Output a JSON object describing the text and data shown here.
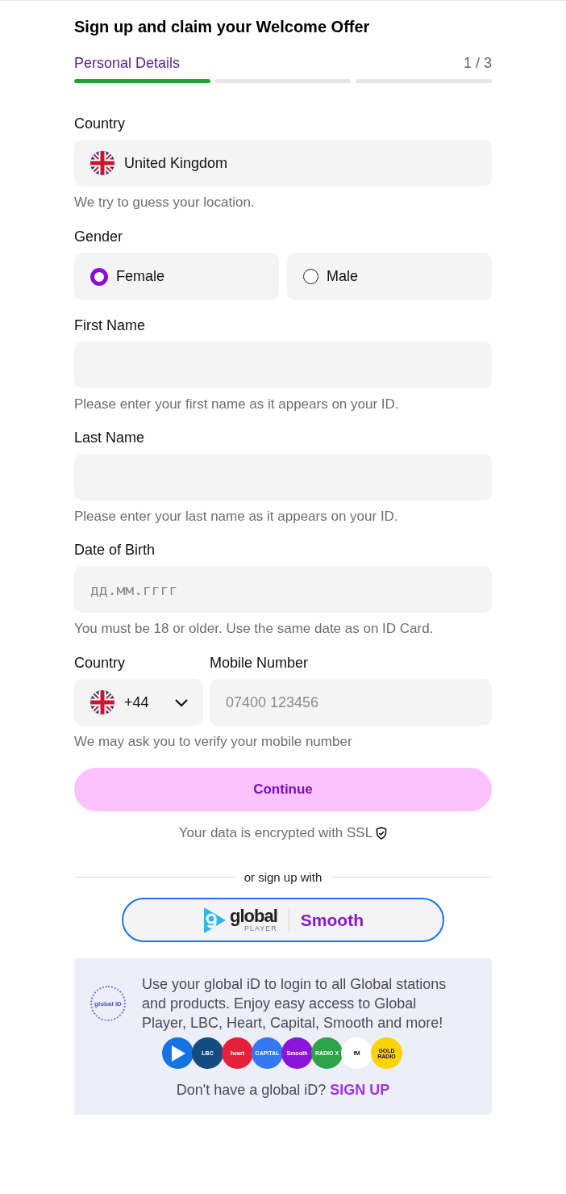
{
  "title": "Sign up and claim your Welcome Offer",
  "progress": {
    "label": "Personal Details",
    "counter": "1 / 3",
    "steps": [
      {
        "completed": true
      },
      {
        "completed": false
      },
      {
        "completed": false
      }
    ]
  },
  "fields": [
    {
      "kind": "country",
      "label": "Country",
      "value": "United Kingdom",
      "helper": "We try to guess your location."
    },
    {
      "kind": "radio",
      "label": "Gender",
      "options": [
        {
          "label": "Female",
          "selected": true
        },
        {
          "label": "Male",
          "selected": false
        }
      ]
    },
    {
      "kind": "text",
      "label": "First Name",
      "helper": "Please enter your first name as it appears on your ID."
    },
    {
      "kind": "text",
      "label": "Last Name",
      "helper": "Please enter your last name as it appears on your ID."
    },
    {
      "kind": "date",
      "label": "Date of Birth",
      "placeholder": "дд.мм.гггг",
      "helper": "You must be 18 or older. Use the same date as on ID Card."
    },
    {
      "kind": "phone",
      "code_label": "Country",
      "code": "+44",
      "label": "Mobile Number",
      "placeholder": "07400 123456",
      "helper": "We may ask you to verify your mobile number"
    }
  ],
  "continue_button": "Continue",
  "ssl_note": "Your data is encrypted with SSL",
  "divider_label": "or sign up with",
  "partner_button": {
    "logo_word": "global",
    "logo_sub": "PLAYER",
    "brand": "Smooth"
  },
  "info": {
    "logo": "global iD",
    "text": "Use your global iD to login to all Global stations and products. Enjoy easy access to Global Player, LBC, Heart, Capital, Smooth and more!",
    "stations": [
      {
        "color": "#1673e6"
      },
      {
        "color": "#144b80",
        "label": "LBC"
      },
      {
        "color": "#e4203a",
        "label": "heart"
      },
      {
        "color": "#3478f0",
        "label": "CAPITAL"
      },
      {
        "color": "#8a15d9",
        "label": "Smooth"
      },
      {
        "color": "#2da447",
        "label": "RADIO X"
      },
      {
        "color": "#ffffff",
        "label": "fM"
      },
      {
        "color": "#fcd307",
        "label": "GOLD RADIO"
      }
    ],
    "prompt": "Don't have a global iD?",
    "link": "SIGN UP"
  }
}
